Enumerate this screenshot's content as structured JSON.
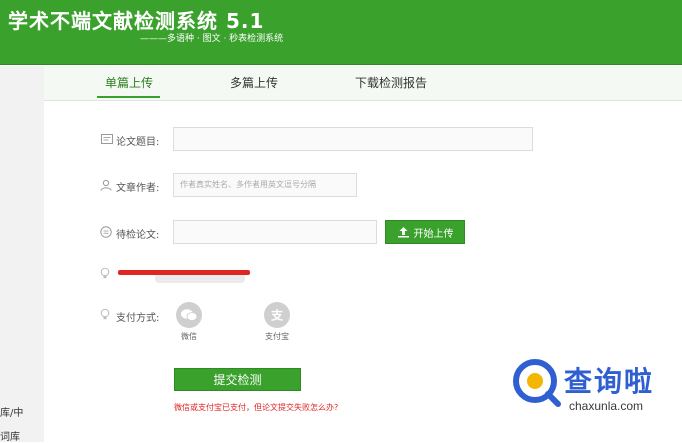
{
  "header": {
    "title": "学术不端文献检测系统 5.1",
    "subtitle": "———多语种 · 图文 · 秒表检测系统"
  },
  "left_strip": {
    "texts": [
      "库/中",
      "词库"
    ]
  },
  "tabs": [
    {
      "label": "单篇上传",
      "active": true
    },
    {
      "label": "多篇上传",
      "active": false
    },
    {
      "label": "下载检测报告",
      "active": false
    }
  ],
  "form": {
    "title_label": "论文题目:",
    "title_value": "",
    "author_label": "文章作者:",
    "author_placeholder": "作者真实姓名、多作者用英文逗号分隔",
    "paper_label": "待检论文:",
    "upload_button": "开始上传",
    "payment_label": "支付方式:",
    "payments": [
      {
        "name": "微信",
        "icon": "wechat-icon"
      },
      {
        "name": "支付宝",
        "icon": "alipay-icon"
      }
    ]
  },
  "actions": {
    "submit_label": "提交检测",
    "help_link": "微信或支付宝已支付，但论文提交失败怎么办?"
  },
  "watermark": {
    "cn": "查询啦",
    "en": "chaxunla.com"
  },
  "colors": {
    "brand_green": "#3aa12c",
    "accent_red": "#e02525",
    "watermark_blue": "#2f5fd0"
  }
}
